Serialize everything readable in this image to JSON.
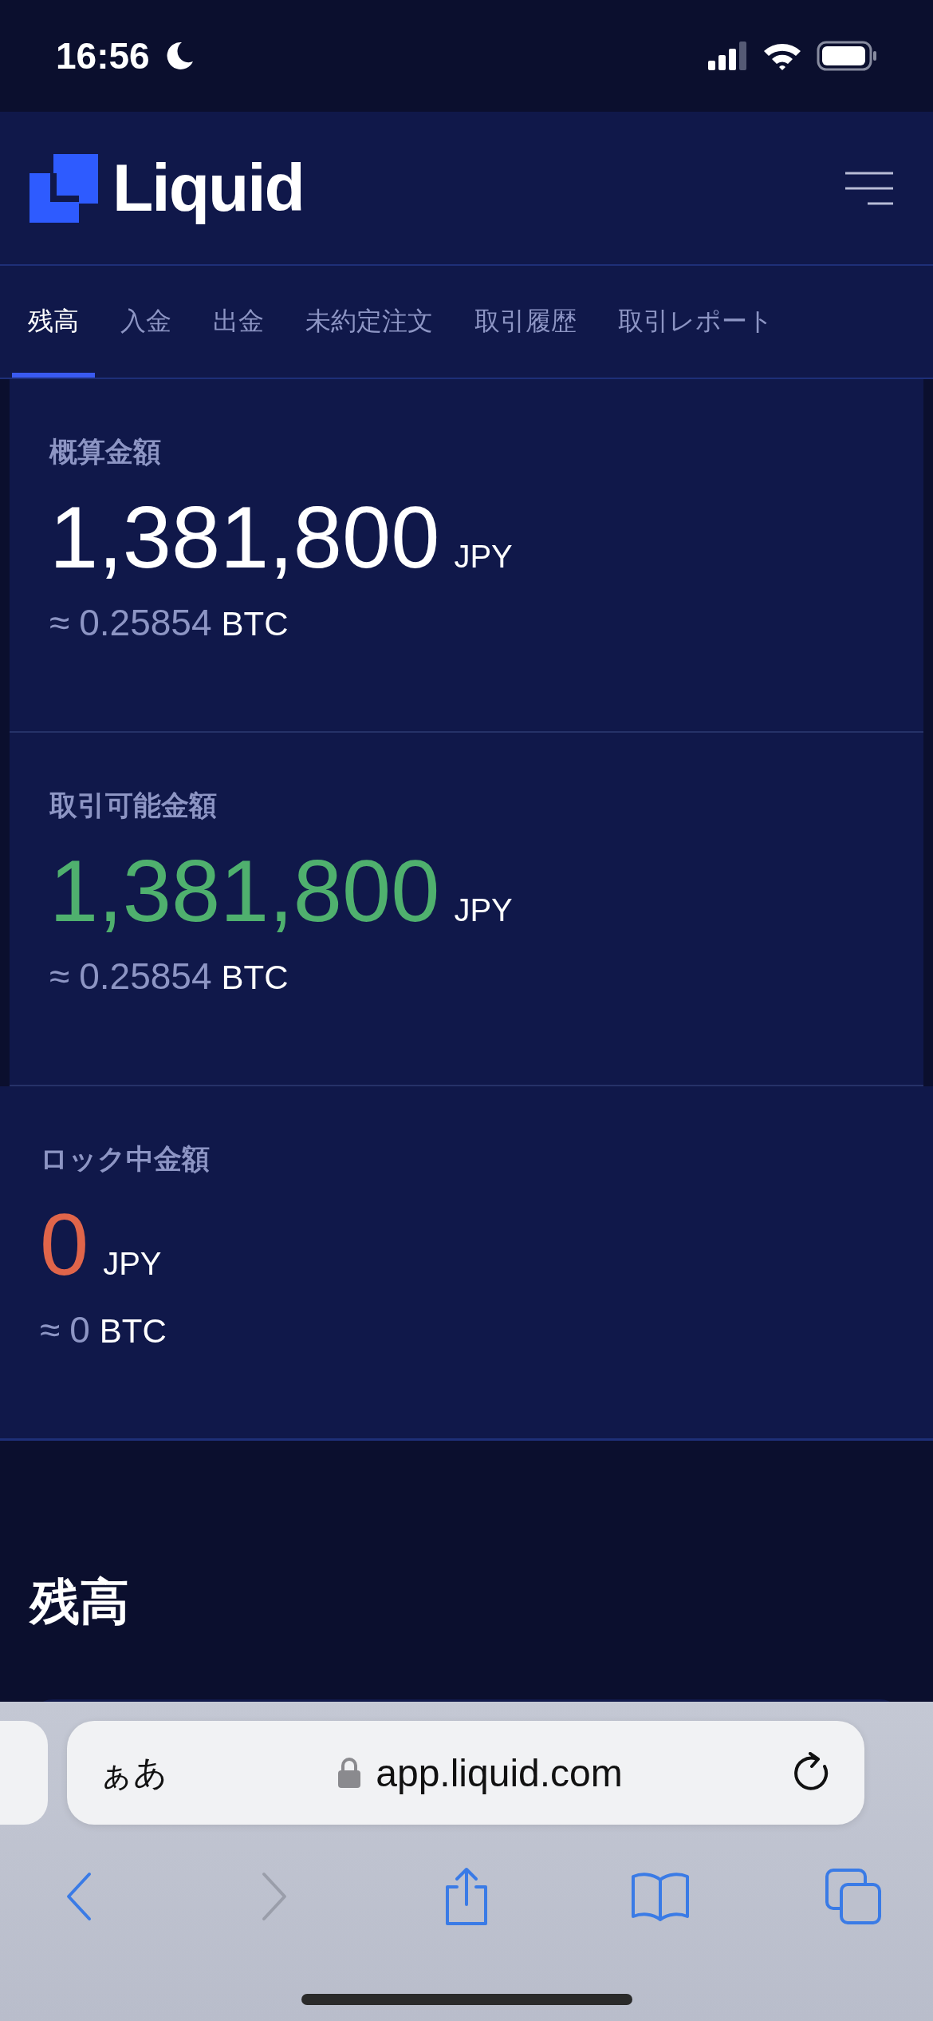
{
  "status_bar": {
    "time": "16:56"
  },
  "header": {
    "brand": "Liquid"
  },
  "tabs": [
    {
      "label": "残高",
      "selected": true
    },
    {
      "label": "入金",
      "selected": false
    },
    {
      "label": "出金",
      "selected": false
    },
    {
      "label": "未約定注文",
      "selected": false
    },
    {
      "label": "取引履歴",
      "selected": false
    },
    {
      "label": "取引レポート",
      "selected": false
    }
  ],
  "summary": [
    {
      "label": "概算金額",
      "amount": "1,381,800",
      "currency": "JPY",
      "color": "#ffffff",
      "approx": "≈",
      "btc_amount": "0.25854",
      "btc_unit": "BTC"
    },
    {
      "label": "取引可能金額",
      "amount": "1,381,800",
      "currency": "JPY",
      "color": "#4fb06e",
      "approx": "≈",
      "btc_amount": "0.25854",
      "btc_unit": "BTC"
    },
    {
      "label": "ロック中金額",
      "amount": "0",
      "currency": "JPY",
      "color": "#e0654a",
      "approx": "≈",
      "btc_amount": "0",
      "btc_unit": "BTC"
    }
  ],
  "section_heading": "残高",
  "browser": {
    "text_size_button": "ぁあ",
    "url": "app.liquid.com",
    "toolbar": [
      {
        "kind": "back",
        "disabled": false
      },
      {
        "kind": "forward",
        "disabled": true
      },
      {
        "kind": "share",
        "disabled": false
      },
      {
        "kind": "bookmarks",
        "disabled": false
      },
      {
        "kind": "tabs",
        "disabled": false
      }
    ]
  }
}
